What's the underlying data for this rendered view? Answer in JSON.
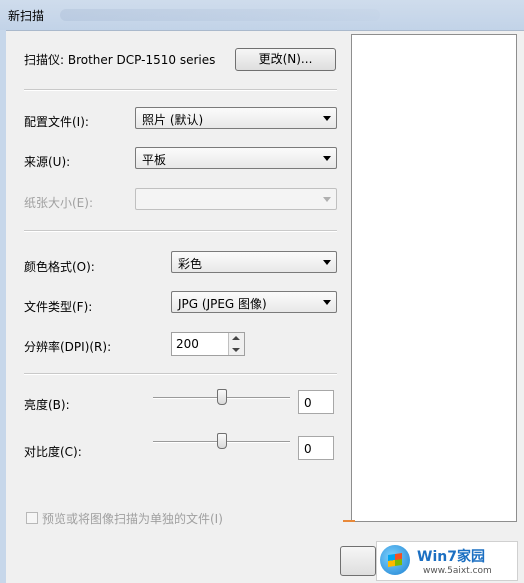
{
  "window": {
    "title": "新扫描"
  },
  "scanner": {
    "label": "扫描仪: Brother DCP-1510 series",
    "change_button": "更改(N)..."
  },
  "profile": {
    "label": "配置文件(I):",
    "value": "照片 (默认)"
  },
  "source": {
    "label": "来源(U):",
    "value": "平板"
  },
  "paper_size": {
    "label": "纸张大小(E):",
    "value": "",
    "disabled": true
  },
  "color_format": {
    "label": "颜色格式(O):",
    "value": "彩色"
  },
  "file_type": {
    "label": "文件类型(F):",
    "value": "JPG (JPEG 图像)"
  },
  "resolution": {
    "label": "分辨率(DPI)(R):",
    "value": "200"
  },
  "brightness": {
    "label": "亮度(B):",
    "value": "0"
  },
  "contrast": {
    "label": "对比度(C):",
    "value": "0"
  },
  "separate_files": {
    "label": "预览或将图像扫描为单独的文件(I)",
    "checked": false,
    "disabled": true
  },
  "watermark": {
    "brand": "Win7家园",
    "site": "www.5aixt.com"
  }
}
